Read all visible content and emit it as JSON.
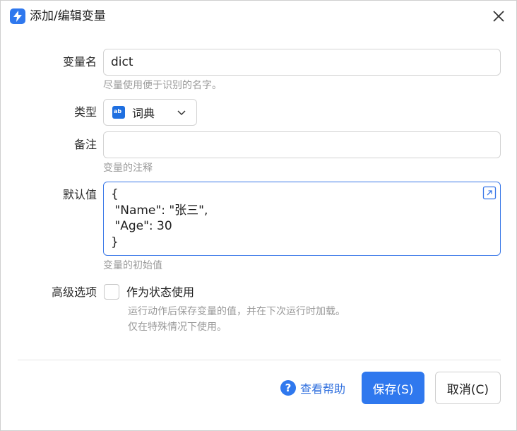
{
  "window": {
    "title": "添加/编辑变量",
    "icon": "lightning-app-icon",
    "close_icon": "close-icon"
  },
  "form": {
    "name": {
      "label": "变量名",
      "value": "dict",
      "hint": "尽量使用便于识别的名字。"
    },
    "type": {
      "label": "类型",
      "value": "词典",
      "icon": "dictionary-type-icon",
      "icon_text": "ab"
    },
    "note": {
      "label": "备注",
      "value": "",
      "hint": "变量的注释"
    },
    "default": {
      "label": "默认值",
      "value": "{\n \"Name\": \"张三\",\n \"Age\": 30\n}",
      "hint": "变量的初始值",
      "expand_icon": "expand-editor-icon"
    },
    "advanced": {
      "label": "高级选项",
      "checkbox_label": "作为状态使用",
      "checked": false,
      "hint_line1": "运行动作后保存变量的值，并在下次运行时加载。",
      "hint_line2": "仅在特殊情况下使用。"
    }
  },
  "footer": {
    "help_label": "查看帮助",
    "help_icon": "question-circle-icon",
    "save_label": "保存(S)",
    "cancel_label": "取消(C)"
  },
  "colors": {
    "accent": "#2f78ee",
    "hint": "#9a9a9a",
    "border": "#d3d3d3"
  }
}
